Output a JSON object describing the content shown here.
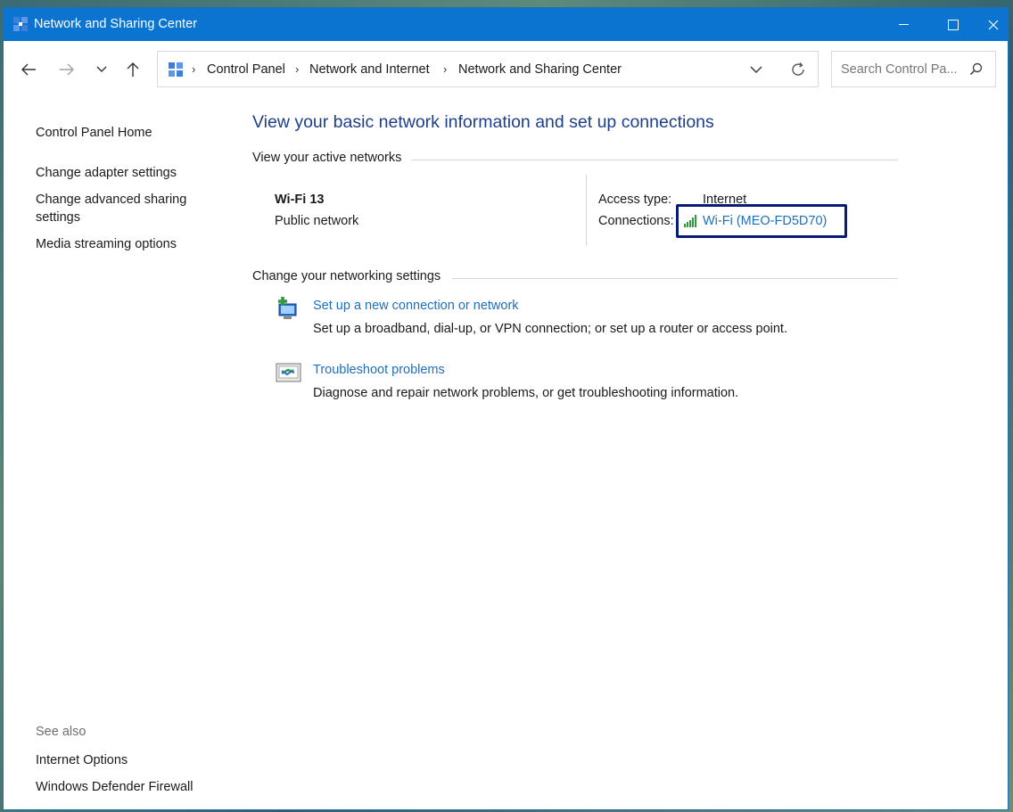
{
  "window": {
    "title": "Network and Sharing Center",
    "accent": "#0b74d1"
  },
  "navbar": {
    "breadcrumb": [
      "Control Panel",
      "Network and Internet",
      "Network and Sharing Center"
    ],
    "search_placeholder": "Search Control Pa..."
  },
  "sidebar": {
    "items": [
      {
        "label": "Control Panel Home"
      },
      {
        "label": "Change adapter settings"
      },
      {
        "label": "Change advanced sharing settings"
      },
      {
        "label": "Media streaming options"
      }
    ],
    "see_also_title": "See also",
    "see_also": [
      {
        "label": "Internet Options"
      },
      {
        "label": "Windows Defender Firewall"
      }
    ]
  },
  "main": {
    "heading": "View your basic network information and set up connections",
    "active_networks_title": "View your active networks",
    "network": {
      "name": "Wi-Fi 13",
      "type": "Public network",
      "access_type_label": "Access type:",
      "access_type_value": "Internet",
      "connections_label": "Connections:",
      "connection_link": "Wi-Fi (MEO-FD5D70)"
    },
    "settings_title": "Change your networking settings",
    "tasks": [
      {
        "link": "Set up a new connection or network",
        "desc": "Set up a broadband, dial-up, or VPN connection; or set up a router or access point."
      },
      {
        "link": "Troubleshoot problems",
        "desc": "Diagnose and repair network problems, or get troubleshooting information."
      }
    ]
  },
  "colors": {
    "link": "#1e6fbf",
    "heading": "#1e3f8b",
    "highlight_box": "#0a1a7a",
    "signal": "#2e9a3a"
  }
}
